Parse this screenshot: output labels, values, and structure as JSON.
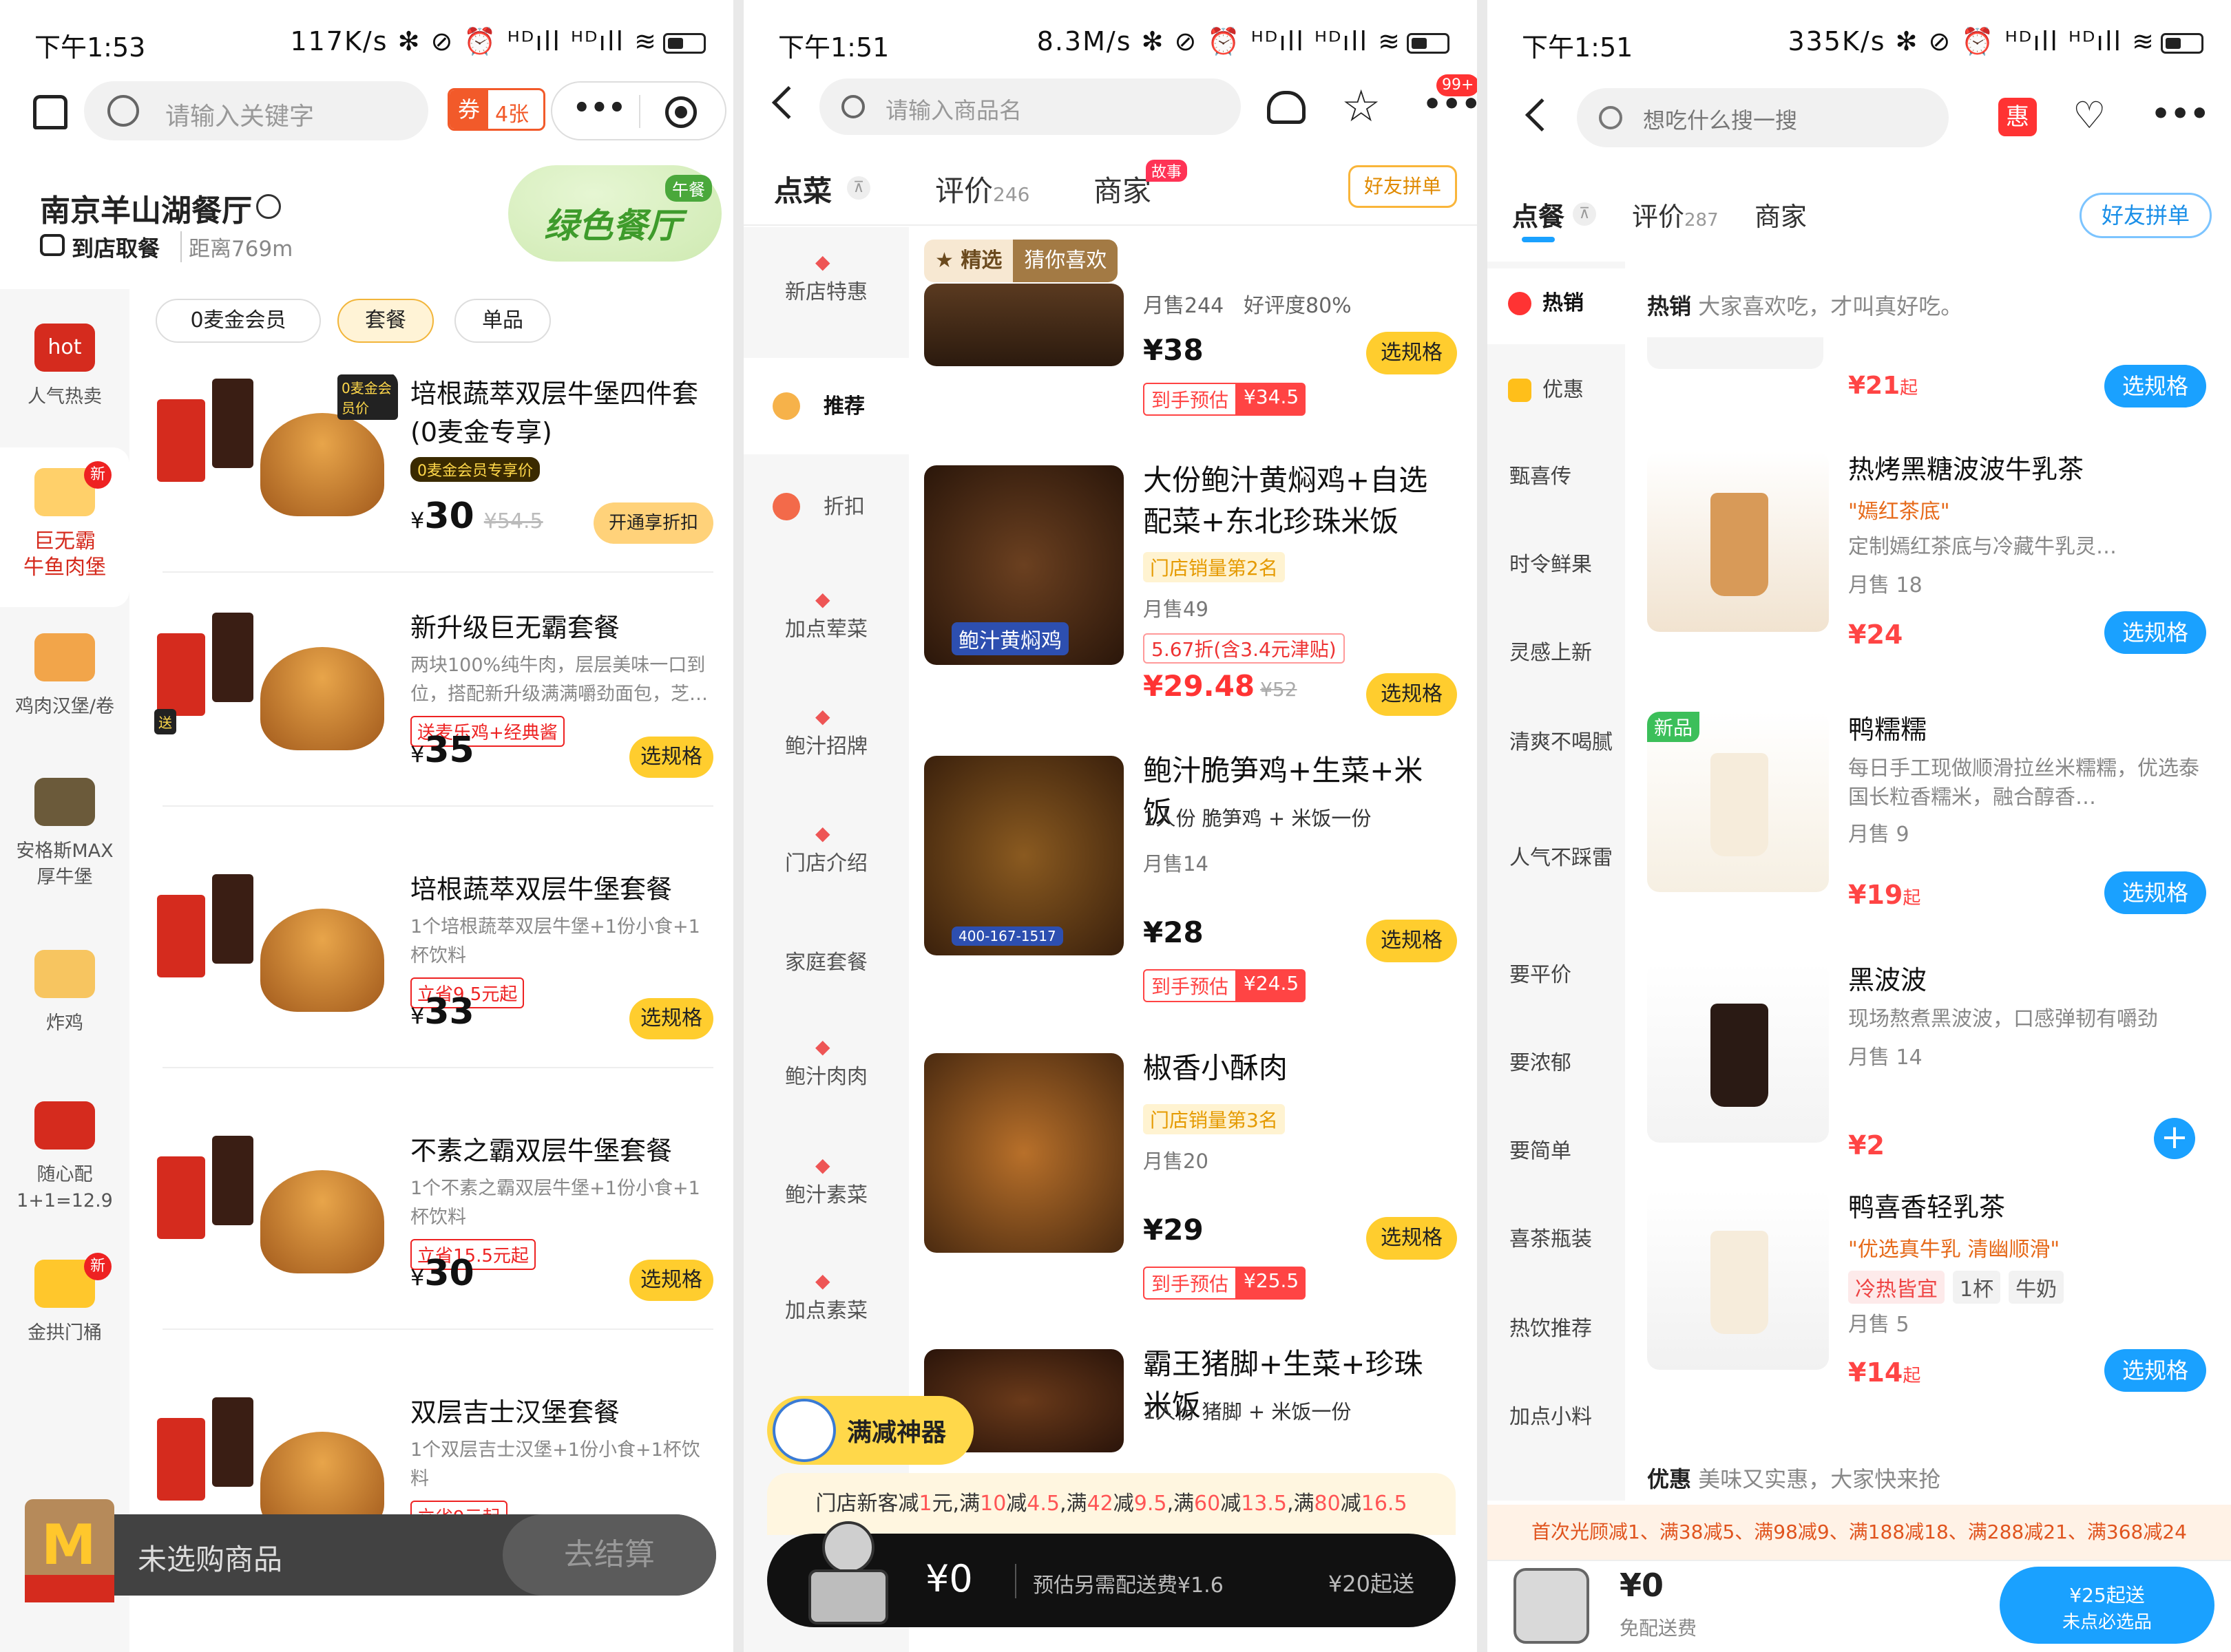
{
  "panel1": {
    "status": {
      "time": "下午1:53",
      "info": "117K/s ✻ ⊘ ⏰ ᴴᴰıll ᴴᴰıll ≋"
    },
    "search": {
      "placeholder": "请输入关键字"
    },
    "coupon": {
      "icon_text": "券",
      "count": "4张"
    },
    "more": "•••",
    "store": {
      "name": "南京羊山湖餐厅",
      "mode": "到店取餐",
      "distance": "距离769m",
      "badge": "绿色餐厅",
      "badge_tag": "午餐"
    },
    "filters": [
      "0麦金会员",
      "套餐",
      "单品"
    ],
    "categories": [
      {
        "label": "人气热卖",
        "icon": "hot-badge-icon",
        "badge": ""
      },
      {
        "label": "巨无霸\n牛鱼肉堡",
        "icon": "big-mac-icon",
        "badge": "新"
      },
      {
        "label": "鸡肉汉堡/卷",
        "icon": "chicken-burger-icon",
        "badge": ""
      },
      {
        "label": "安格斯MAX\n厚牛堡",
        "icon": "angus-icon",
        "badge": ""
      },
      {
        "label": "炸鸡",
        "icon": "fried-chicken-icon",
        "badge": ""
      },
      {
        "label": "随心配\n1+1=12.9",
        "icon": "one-plus-one-icon",
        "badge": ""
      },
      {
        "label": "金拱门桶",
        "icon": "bucket-icon",
        "badge": "新"
      }
    ],
    "products": [
      {
        "title": "培根蔬萃双层牛堡四件套(0麦金专享)",
        "desc": "",
        "tag": "0麦金会员专享价",
        "price": "30",
        "orig": "¥54.5",
        "btn": "开通享折扣",
        "img_tag": "0麦金会员价"
      },
      {
        "title": "新升级巨无霸套餐",
        "desc": "两块100%纯牛肉，层层美味一口到位，搭配新升级满满嚼劲面包，芝…",
        "tag": "送麦乐鸡+经典酱",
        "price": "35",
        "orig": "",
        "btn": "选规格",
        "img_tag": "送"
      },
      {
        "title": "培根蔬萃双层牛堡套餐",
        "desc": "1个培根蔬萃双层牛堡+1份小食+1杯饮料",
        "tag": "立省9.5元起",
        "price": "33",
        "orig": "",
        "btn": "选规格",
        "img_tag": ""
      },
      {
        "title": "不素之霸双层牛堡套餐",
        "desc": "1个不素之霸双层牛堡+1份小食+1杯饮料",
        "tag": "立省15.5元起",
        "price": "30",
        "orig": "",
        "btn": "选规格",
        "img_tag": ""
      },
      {
        "title": "双层吉士汉堡套餐",
        "desc": "1个双层吉士汉堡+1份小食+1杯饮料",
        "tag": "立省9元起",
        "price": "",
        "orig": "",
        "btn": "",
        "img_tag": ""
      }
    ],
    "currency": "¥",
    "cart": {
      "empty": "未选购商品",
      "checkout": "去结算"
    }
  },
  "panel2": {
    "status": {
      "time": "下午1:51",
      "info": "8.3M/s ✻ ⊘ ⏰ ᴴᴰıll ᴴᴰıll ≋"
    },
    "search": {
      "placeholder": "请输入商品名"
    },
    "badge": "99+",
    "tabs": {
      "order": "点菜",
      "review": "评价",
      "review_count": "246",
      "merchant": "商家",
      "merchant_tag": "故事",
      "group": "好友拼单"
    },
    "categories": [
      "新店特惠",
      "推荐",
      "折扣",
      "加点荤菜",
      "鲍汁招牌",
      "门店介绍",
      "家庭套餐",
      "鲍汁肉肉",
      "鲍汁素菜",
      "加点素菜"
    ],
    "section_tag": {
      "a": "精选",
      "b": "猜你喜欢"
    },
    "top_item": {
      "sales": "月售244",
      "rating": "好评度80%",
      "price": "¥38",
      "est_label": "到手预估",
      "est": "¥34.5",
      "btn": "选规格"
    },
    "items": [
      {
        "title": "大份鲍汁黄焖鸡+自选配菜+东北珍珠米饭",
        "rank": "门店销量第2名",
        "spec": "",
        "sales": "月售49",
        "discount": "5.67折(含3.4元津贴)",
        "price": "¥29.48",
        "orig": "¥52",
        "est": "",
        "btn": "选规格",
        "img_text": "鲍汁黄焖鸡"
      },
      {
        "title": "鲍汁脆笋鸡+生菜+米饭",
        "rank": "",
        "spec": "1人份  脆笋鸡 + 米饭一份",
        "sales": "月售14",
        "discount": "",
        "price": "¥28",
        "orig": "",
        "est": "¥24.5",
        "btn": "选规格",
        "img_text": "400-167-1517"
      },
      {
        "title": "椒香小酥肉",
        "rank": "门店销量第3名",
        "spec": "",
        "sales": "月售20",
        "discount": "",
        "price": "¥29",
        "orig": "",
        "est": "¥25.5",
        "btn": "选规格",
        "img_text": ""
      },
      {
        "title": "霸王猪脚+生菜+珍珠米饭",
        "rank": "",
        "spec": "1人份  猪脚 + 米饭一份",
        "sales": "",
        "discount": "",
        "price": "",
        "orig": "",
        "est": "",
        "btn": "",
        "img_text": ""
      }
    ],
    "est_label": "到手预估",
    "promo_tool": "满减神器",
    "promo": {
      "prefix": "门店新客减",
      "p1": "1",
      "t1": "元,满",
      "p2": "10",
      "t2": "减",
      "p3": "4.5",
      "t3": ",满",
      "p4": "42",
      "t4": "减",
      "p5": "9.5",
      "t5": ",满",
      "p6": "60",
      "t6": "减",
      "p7": "13.5",
      "t7": ",满",
      "p8": "80",
      "t8": "减",
      "p9": "16.5"
    },
    "cart": {
      "amount": "¥0",
      "delivery": "预估另需配送费¥1.6",
      "min": "¥20起送"
    }
  },
  "panel3": {
    "status": {
      "time": "下午1:51",
      "info": "335K/s ✻ ⊘ ⏰ ᴴᴰıll ᴴᴰıll ≋"
    },
    "search": {
      "placeholder": "想吃什么搜一搜"
    },
    "hui": "惠",
    "tabs": {
      "order": "点餐",
      "review": "评价",
      "review_count": "287",
      "merchant": "商家",
      "group": "好友拼单"
    },
    "categories": [
      "热销",
      "优惠",
      "甄喜传",
      "时令鲜果",
      "灵感上新",
      "清爽不喝腻",
      "人气不踩雷",
      "要平价",
      "要浓郁",
      "要简单",
      "喜茶瓶装",
      "热饮推荐",
      "加点小料"
    ],
    "section_header": {
      "title": "热销",
      "desc": "大家喜欢吃，才叫真好吃。"
    },
    "top_item": {
      "price": "¥21",
      "suffix": "起",
      "btn": "选规格"
    },
    "items": [
      {
        "title": "热烤黑糖波波牛乳茶",
        "slogan": "\"嫣红茶底\"",
        "desc": "定制嫣红茶底与冷藏牛乳灵…",
        "sales": "月售 18",
        "price": "¥24",
        "suffix": "",
        "btn": "选规格",
        "tags": [],
        "badge": ""
      },
      {
        "title": "鸭糯糯",
        "slogan": "",
        "desc": "每日手工现做顺滑拉丝米糯糯，优选泰国长粒香糯米，融合醇香…",
        "sales": "月售 9",
        "price": "¥19",
        "suffix": "起",
        "btn": "选规格",
        "tags": [],
        "badge": "新品"
      },
      {
        "title": "黑波波",
        "slogan": "",
        "desc": "现场熬煮黑波波，口感弹韧有嚼劲",
        "sales": "月售 14",
        "price": "¥2",
        "suffix": "",
        "btn": "+",
        "tags": [],
        "badge": ""
      },
      {
        "title": "鸭喜香轻乳茶",
        "slogan": "\"优选真牛乳 清幽顺滑\"",
        "desc": "",
        "sales": "月售 5",
        "price": "¥14",
        "suffix": "起",
        "btn": "选规格",
        "tags": [
          "冷热皆宜",
          "1杯",
          "牛奶"
        ],
        "badge": ""
      }
    ],
    "section2": {
      "title": "优惠",
      "desc": "美味又实惠，大家快来抢"
    },
    "promo": "首次光顾减1、满38减5、满98减9、满188减18、满288减21、满368减24",
    "cart": {
      "amount": "¥0",
      "delivery": "免配送费",
      "btn_line1": "¥25起送",
      "btn_line2": "未点必选品"
    }
  }
}
